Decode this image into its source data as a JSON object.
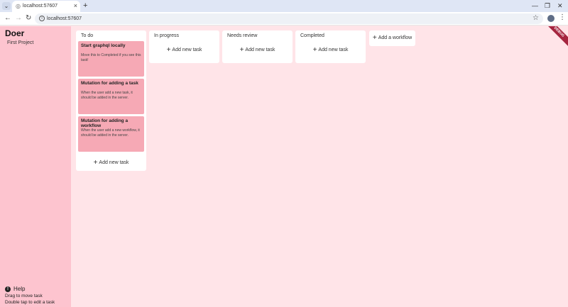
{
  "browser": {
    "tab_title": "localhost:57607",
    "url": "localhost:57607"
  },
  "app": {
    "title": "Doer",
    "projects": [
      "First Project"
    ],
    "help": {
      "title": "Help",
      "lines": [
        "Drag to move task",
        "Double tap to edit a task"
      ]
    },
    "debug_banner": "DEBUG"
  },
  "board": {
    "add_task_label": "Add new task",
    "add_workflow_label": "Add a workflow",
    "columns": [
      {
        "title": "To do",
        "cards": [
          {
            "title": "Start graphql locally",
            "description": "Move this to Completed if you see this task!"
          },
          {
            "title": "Mutation for adding a task",
            "description": "When the user add a new task, it should be added in the server."
          },
          {
            "title": "Mutation for adding a workflow",
            "description": "When the user add a new workflow, it should be added in the server."
          }
        ]
      },
      {
        "title": "In progress",
        "cards": []
      },
      {
        "title": "Needs review",
        "cards": []
      },
      {
        "title": "Completed",
        "cards": []
      }
    ]
  },
  "colors": {
    "sidebar_bg": "#fdc4cf",
    "board_bg": "#ffe4e8",
    "card_bg": "#f6a9b5",
    "banner": "#a5253f"
  }
}
